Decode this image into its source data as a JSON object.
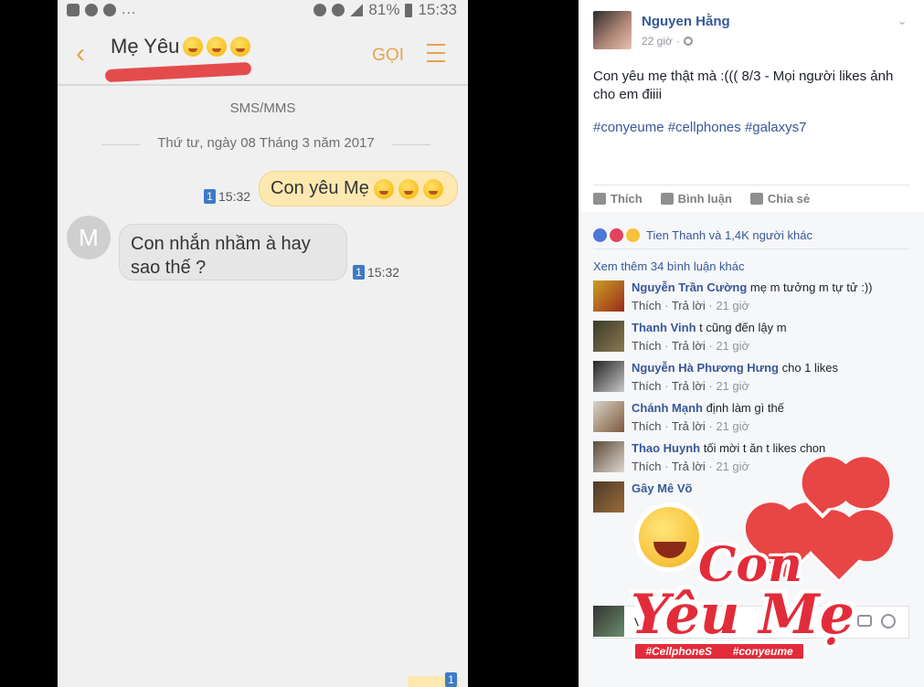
{
  "phone": {
    "status": {
      "dots": "...",
      "battery_pct": "81%",
      "clock": "15:33"
    },
    "header": {
      "contact_name": "Mẹ Yêu",
      "call_label": "GỌI",
      "back_icon": "chevron-left-icon",
      "menu_icon": "hamburger-menu-icon",
      "accent_color": "#e8a24a"
    },
    "thread": {
      "channel_label": "SMS/MMS",
      "date_label": "Thứ tư, ngày 08 Tháng 3 năm 2017",
      "outgoing": {
        "text": "Con yêu Mẹ",
        "sim": "1",
        "time": "15:32"
      },
      "incoming": {
        "avatar_letter": "M",
        "text": "Con nhắn nhầm à hay sao thế ?",
        "sim": "1",
        "time": "15:32"
      }
    },
    "composer": {
      "sim": "1"
    }
  },
  "facebook": {
    "post": {
      "author": "Nguyen Hằng",
      "time": "22 giờ",
      "text": "Con yêu mẹ thật mà :((( 8/3 - Mọi người likes ảnh cho em điiii",
      "hashtags": "#conyeume #cellphones #galaxys7"
    },
    "actions": {
      "like": "Thích",
      "comment": "Bình luận",
      "share": "Chia sẻ"
    },
    "reactions": {
      "summary": "Tien Thanh và 1,4K người khác"
    },
    "more_comments": "Xem thêm 34 bình luận khác",
    "comments": [
      {
        "name": "Nguyễn Trần Cường",
        "text": "mẹ m tưởng m tự tử :))",
        "like": "Thích",
        "reply": "Trả lời",
        "time": "21 giờ"
      },
      {
        "name": "Thanh Vinh",
        "text": "t cũng đến lậy m",
        "like": "Thích",
        "reply": "Trả lời",
        "time": "21 giờ"
      },
      {
        "name": "Nguyễn Hà Phương Hưng",
        "text": "cho 1 likes",
        "like": "Thích",
        "reply": "Trả lời",
        "time": "21 giờ"
      },
      {
        "name": "Chánh Mạnh",
        "text": "định làm gì thế",
        "like": "Thích",
        "reply": "Trả lời",
        "time": "21 giờ"
      },
      {
        "name": "Thao Huynh",
        "text": "tối mời t ăn t likes chon",
        "like": "Thích",
        "reply": "Trả lời",
        "time": "21 giờ"
      },
      {
        "name": "Gây Mê Võ",
        "text": ""
      }
    ],
    "composer": {
      "prefix": "V"
    }
  },
  "sticker": {
    "line1": "Con",
    "line2": "Yêu Mẹ",
    "tag1": "#CellphoneS",
    "tag2": "#conyeume"
  }
}
